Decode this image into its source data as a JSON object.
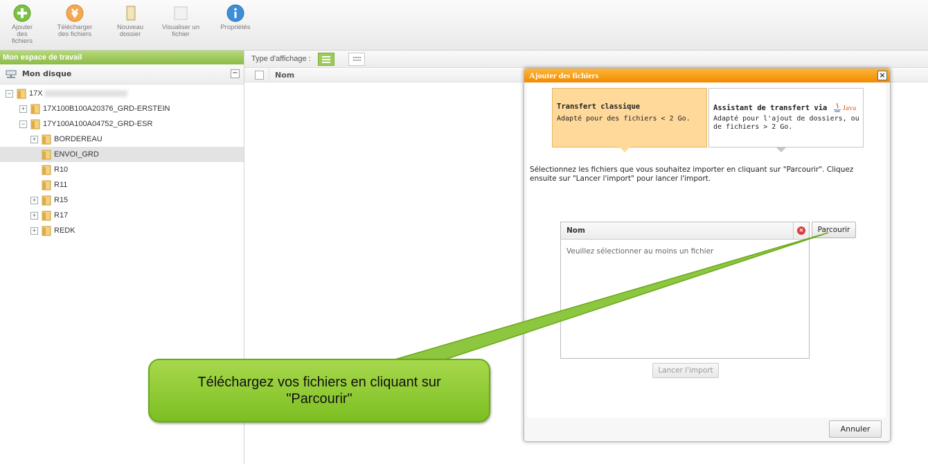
{
  "toolbar": {
    "buttons": [
      {
        "line1": "Ajouter des",
        "line2": "fichiers"
      },
      {
        "line1": "Télécharger",
        "line2": "des fichiers"
      },
      {
        "line1": "Nouveau",
        "line2": "dossier"
      },
      {
        "line1": "Visualiser un",
        "line2": "fichier"
      },
      {
        "line1": "Propriétés",
        "line2": ""
      }
    ],
    "icons": [
      "add-icon",
      "download-icon",
      "new-folder-icon",
      "view-file-icon",
      "info-icon"
    ]
  },
  "sidebar": {
    "header": "Mon espace de travail",
    "disk_label": "Mon disque",
    "collapse_symbol": "−",
    "tree": [
      {
        "label": "17X",
        "expander": "−",
        "redacted": true
      },
      {
        "label": "17X100B100A20376_GRD-ERSTEIN",
        "expander": "+"
      },
      {
        "label": "17Y100A100A04752_GRD-ESR",
        "expander": "−"
      },
      {
        "label": "BORDEREAU",
        "expander": "+"
      },
      {
        "label": "ENVOI_GRD",
        "expander": "",
        "selected": true
      },
      {
        "label": "R10",
        "expander": ""
      },
      {
        "label": "R11",
        "expander": ""
      },
      {
        "label": "R15",
        "expander": "+"
      },
      {
        "label": "R17",
        "expander": "+"
      },
      {
        "label": "REDK",
        "expander": "+"
      }
    ]
  },
  "main": {
    "type_label": "Type d'affichage :",
    "column_name": "Nom"
  },
  "dialog": {
    "title": "Ajouter des fichiers",
    "close_symbol": "×",
    "tabs": [
      {
        "title": "Transfert classique",
        "desc": "Adapté pour des fichiers < 2 Go."
      },
      {
        "title": "Assistant de transfert via",
        "desc": "Adapté pour l'ajout de dossiers, ou de fichiers > 2 Go.",
        "brand": "Java"
      }
    ],
    "instructions": "Sélectionnez les fichiers que vous souhaitez importer en cliquant sur \"Parcourir\". Cliquez ensuite sur \"Lancer l'import\" pour lancer l'import.",
    "file_column": "Nom",
    "empty_text": "Veuillez sélectionner au moins un fichier",
    "browse_label": "Parcourir",
    "import_label": "Lancer l'import",
    "cancel_label": "Annuler"
  },
  "callout": {
    "text_line1": "Téléchargez vos fichiers en cliquant sur",
    "text_line2": "\"Parcourir\""
  },
  "colors": {
    "accent_orange": "#f29a0f",
    "workspace_green": "#9ccb5a",
    "callout_green": "#8dc63f",
    "tab_active_bg": "#fed99a"
  }
}
